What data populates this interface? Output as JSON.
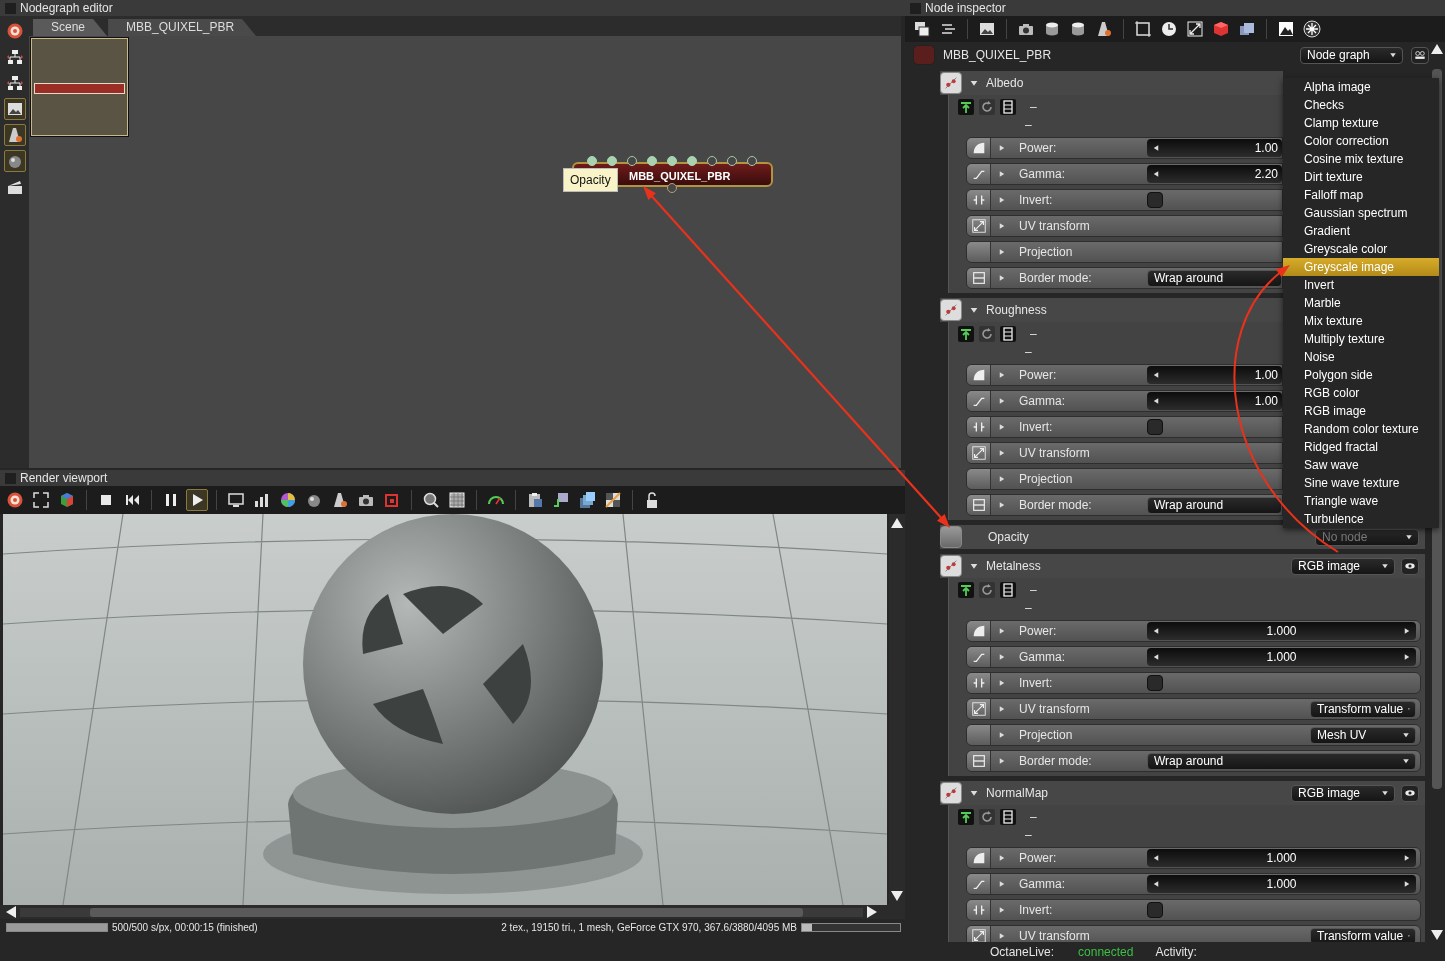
{
  "nodegraph": {
    "title": "Nodegraph editor",
    "tools": [
      {
        "on": false
      },
      {
        "on": false
      },
      {
        "on": false
      },
      {
        "on": true
      },
      {
        "on": true
      },
      {
        "on": true
      },
      {
        "on": false
      }
    ],
    "tabs": [
      {
        "label": "Scene",
        "selected": true
      },
      {
        "label": "MBB_QUIXEL_PBR",
        "selected": false
      }
    ],
    "node": {
      "name": "MBB_QUIXEL_PBR",
      "tooltip": "Opacity",
      "pins": [
        {
          "connected": true
        },
        {
          "connected": true
        },
        {
          "connected": false
        },
        {
          "connected": true
        },
        {
          "connected": true
        },
        {
          "connected": true
        },
        {
          "connected": false
        },
        {
          "connected": false
        },
        {
          "connected": false
        }
      ],
      "output_pin": {
        "connected": false
      }
    }
  },
  "viewport": {
    "title": "Render viewport",
    "play_active": true,
    "progress": {
      "level": 1.0
    },
    "status": "500/500 s/px, 00:00:15 (finished)",
    "stats": "2 tex., 19150 tri., 1 mesh, GeForce GTX 970, 367.6/3880/4095 MB",
    "memory": {
      "level": 0.1
    }
  },
  "inspector": {
    "title": "Node inspector",
    "node_name": "MBB_QUIXEL_PBR",
    "graph_type": "Node graph",
    "sections": [
      {
        "kind": "texture",
        "label": "Albedo",
        "expanded": true,
        "under_menu": true,
        "info": [
          "–",
          "–"
        ],
        "params": [
          {
            "kind": "slider",
            "label": "Power:",
            "value": "1.00"
          },
          {
            "kind": "slider",
            "label": "Gamma:",
            "value": "2.20"
          },
          {
            "kind": "checkbox",
            "label": "Invert:",
            "checked": false
          },
          {
            "kind": "link",
            "label": "UV transform"
          },
          {
            "kind": "link",
            "label": "Projection"
          },
          {
            "kind": "dropdown",
            "label": "Border mode:",
            "value": "Wrap around"
          }
        ]
      },
      {
        "kind": "texture",
        "label": "Roughness",
        "expanded": true,
        "under_menu": true,
        "info": [
          "–",
          "–"
        ],
        "params": [
          {
            "kind": "slider",
            "label": "Power:",
            "value": "1.00"
          },
          {
            "kind": "slider",
            "label": "Gamma:",
            "value": "1.00"
          },
          {
            "kind": "checkbox",
            "label": "Invert:",
            "checked": false
          },
          {
            "kind": "link",
            "label": "UV transform"
          },
          {
            "kind": "link",
            "label": "Projection"
          },
          {
            "kind": "dropdown",
            "label": "Border mode:",
            "value": "Wrap around"
          }
        ]
      },
      {
        "kind": "empty",
        "label": "Opacity",
        "dropdown": "No node",
        "disabled": true
      },
      {
        "kind": "texture",
        "label": "Metalness",
        "expanded": true,
        "under_menu": false,
        "dropdown": "RGB image",
        "info": [
          "–",
          "–"
        ],
        "params": [
          {
            "kind": "slider",
            "label": "Power:",
            "value": "1.000"
          },
          {
            "kind": "slider",
            "label": "Gamma:",
            "value": "1.000"
          },
          {
            "kind": "checkbox",
            "label": "Invert:",
            "checked": false
          },
          {
            "kind": "link",
            "label": "UV transform",
            "value": "Transform value"
          },
          {
            "kind": "link",
            "label": "Projection",
            "value": "Mesh UV"
          },
          {
            "kind": "dropdown",
            "label": "Border mode:",
            "value": "Wrap around"
          }
        ]
      },
      {
        "kind": "texture",
        "label": "NormalMap",
        "expanded": true,
        "under_menu": false,
        "dropdown": "RGB image",
        "info": [
          "–",
          "–"
        ],
        "params": [
          {
            "kind": "slider",
            "label": "Power:",
            "value": "1.000"
          },
          {
            "kind": "slider",
            "label": "Gamma:",
            "value": "1.000"
          },
          {
            "kind": "checkbox",
            "label": "Invert:",
            "checked": false
          },
          {
            "kind": "link",
            "label": "UV transform",
            "value": "Transform value"
          }
        ]
      }
    ],
    "menu": [
      {
        "label": "Alpha image",
        "selected": false
      },
      {
        "label": "Checks",
        "selected": false
      },
      {
        "label": "Clamp texture",
        "selected": false
      },
      {
        "label": "Color correction",
        "selected": false
      },
      {
        "label": "Cosine mix texture",
        "selected": false
      },
      {
        "label": "Dirt texture",
        "selected": false
      },
      {
        "label": "Falloff map",
        "selected": false
      },
      {
        "label": "Gaussian spectrum",
        "selected": false
      },
      {
        "label": "Gradient",
        "selected": false
      },
      {
        "label": "Greyscale color",
        "selected": false
      },
      {
        "label": "Greyscale image",
        "selected": true
      },
      {
        "label": "Invert",
        "selected": false
      },
      {
        "label": "Marble",
        "selected": false
      },
      {
        "label": "Mix texture",
        "selected": false
      },
      {
        "label": "Multiply texture",
        "selected": false
      },
      {
        "label": "Noise",
        "selected": false
      },
      {
        "label": "Polygon side",
        "selected": false
      },
      {
        "label": "RGB color",
        "selected": false
      },
      {
        "label": "RGB image",
        "selected": false
      },
      {
        "label": "Random color texture",
        "selected": false
      },
      {
        "label": "Ridged fractal",
        "selected": false
      },
      {
        "label": "Saw wave",
        "selected": false
      },
      {
        "label": "Sine wave texture",
        "selected": false
      },
      {
        "label": "Triangle wave",
        "selected": false
      },
      {
        "label": "Turbulence",
        "selected": false
      }
    ]
  },
  "status_bar": {
    "live_label": "OctaneLive:",
    "live_value": "connected",
    "activity_label": "Activity:"
  }
}
